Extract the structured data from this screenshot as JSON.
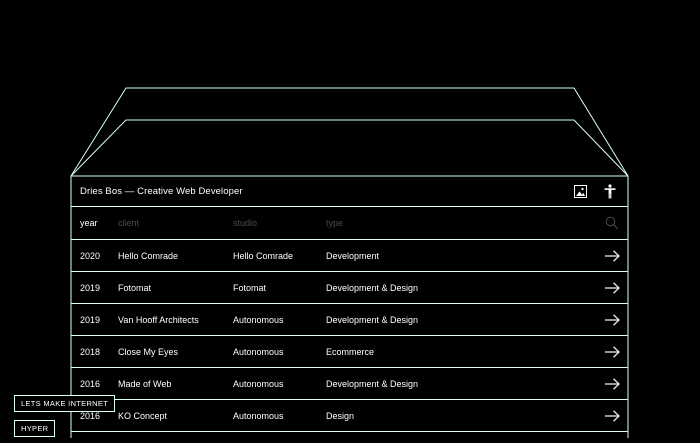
{
  "header": {
    "title": "Dries Bos — Creative Web Developer",
    "image_icon": "image-icon",
    "accessibility_icon": "accessibility-icon"
  },
  "table": {
    "columns": [
      "year",
      "client",
      "studio",
      "type"
    ],
    "search_icon": "search-icon",
    "rows": [
      {
        "year": "2020",
        "client": "Hello Comrade",
        "studio": "Hello Comrade",
        "type": "Development"
      },
      {
        "year": "2019",
        "client": "Fotomat",
        "studio": "Fotomat",
        "type": "Development & Design"
      },
      {
        "year": "2019",
        "client": "Van Hooff Architects",
        "studio": "Autonomous",
        "type": "Development & Design"
      },
      {
        "year": "2018",
        "client": "Close My Eyes",
        "studio": "Autonomous",
        "type": "Ecommerce"
      },
      {
        "year": "2016",
        "client": "Made of Web",
        "studio": "Autonomous",
        "type": "Development & Design"
      },
      {
        "year": "2016",
        "client": "KO Concept",
        "studio": "Autonomous",
        "type": "Design"
      }
    ],
    "row_icon": "arrow-right-icon"
  },
  "badges": {
    "primary": "LETS MAKE INTERNET",
    "secondary": "HYPER"
  },
  "colors": {
    "background": "#000000",
    "line": "#d9fff9",
    "text": "#ffffff",
    "muted": "#4a4a4a"
  }
}
